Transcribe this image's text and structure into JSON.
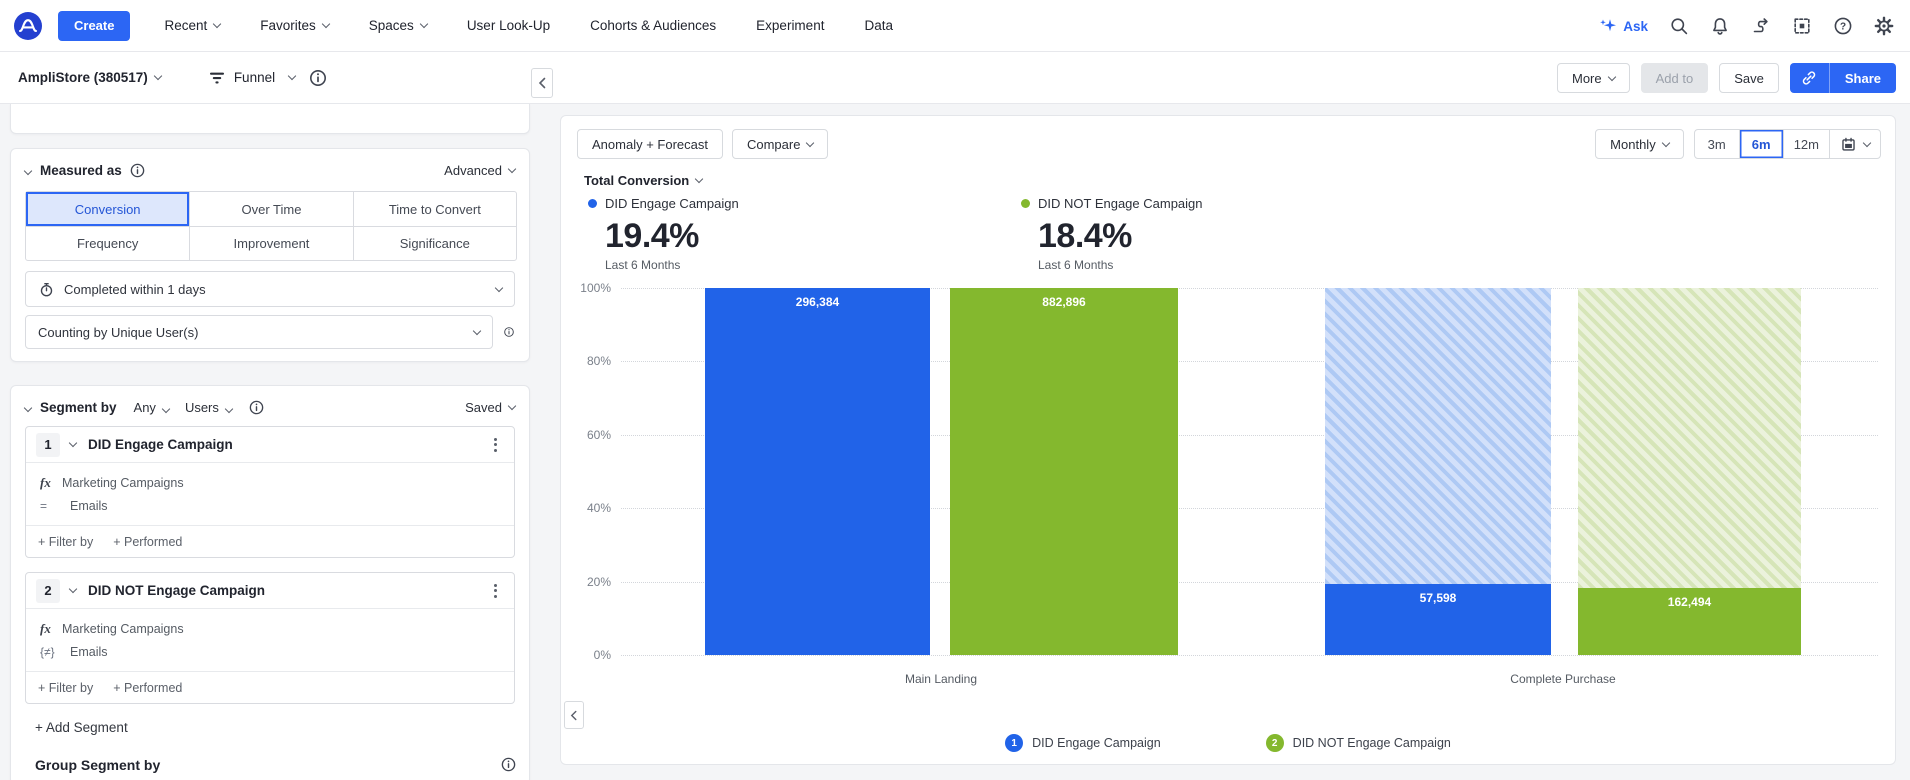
{
  "nav": {
    "create_label": "Create",
    "items": [
      {
        "label": "Recent"
      },
      {
        "label": "Favorites"
      },
      {
        "label": "Spaces"
      },
      {
        "label": "User Look-Up"
      },
      {
        "label": "Cohorts & Audiences"
      },
      {
        "label": "Experiment"
      },
      {
        "label": "Data"
      }
    ],
    "ask_label": "Ask"
  },
  "toolbar": {
    "project": "AmpliStore (380517)",
    "chart_type": "Funnel",
    "more_label": "More",
    "add_to_label": "Add to",
    "save_label": "Save",
    "share_label": "Share"
  },
  "sidebar": {
    "measured": {
      "title": "Measured as",
      "advanced_label": "Advanced",
      "tabs": [
        "Conversion",
        "Over Time",
        "Time to Convert",
        "Frequency",
        "Improvement",
        "Significance"
      ],
      "selected_tab": "Conversion",
      "completed_within": "Completed within 1 days",
      "counting_by": "Counting by Unique User(s)"
    },
    "segment": {
      "title": "Segment by",
      "any_label": "Any",
      "users_label": "Users",
      "saved_label": "Saved",
      "segments": [
        {
          "index": "1",
          "name": "DID Engage Campaign",
          "event": "Marketing Campaigns",
          "operator": "=",
          "value": "Emails",
          "filter_by": "+ Filter by",
          "performed": "+ Performed"
        },
        {
          "index": "2",
          "name": "DID NOT Engage Campaign",
          "event": "Marketing Campaigns",
          "operator": "{≠}",
          "value": "Emails",
          "filter_by": "+ Filter by",
          "performed": "+ Performed"
        }
      ],
      "add_segment_label": "+ Add Segment"
    },
    "group_segment_title": "Group Segment by"
  },
  "chart_panel": {
    "anomaly_label": "Anomaly + Forecast",
    "compare_label": "Compare",
    "interval_label": "Monthly",
    "ranges": [
      "3m",
      "6m",
      "12m"
    ],
    "active_range": "6m",
    "metric_dropdown": "Total Conversion",
    "metrics": [
      {
        "name": "DID Engage Campaign",
        "value": "19.4%",
        "period": "Last 6 Months",
        "color": "#2163e8"
      },
      {
        "name": "DID NOT Engage Campaign",
        "value": "18.4%",
        "period": "Last 6 Months",
        "color": "#84b82e"
      }
    ]
  },
  "chart_data": {
    "type": "bar",
    "subtype": "funnel-conversion",
    "title": "Total Conversion",
    "categories": [
      "Main Landing",
      "Complete Purchase"
    ],
    "series": [
      {
        "name": "DID Engage Campaign",
        "color": "#2163e8",
        "values": [
          296384,
          57598
        ],
        "value_labels": [
          "296,384",
          "57,598"
        ],
        "conversion_pct": [
          100,
          19.4
        ]
      },
      {
        "name": "DID NOT Engage Campaign",
        "color": "#84b82e",
        "values": [
          882896,
          162494
        ],
        "value_labels": [
          "882,896",
          "162,494"
        ],
        "conversion_pct": [
          100,
          18.4
        ]
      }
    ],
    "ylim": [
      0,
      100
    ],
    "yticks": [
      "100%",
      "80%",
      "60%",
      "40%",
      "20%",
      "0%"
    ],
    "grid": "dotted-horizontal",
    "legend_position": "bottom",
    "dropoff_style": "hatched-above-bar"
  },
  "legend": {
    "items": [
      {
        "badge": "1",
        "label": "DID Engage Campaign"
      },
      {
        "badge": "2",
        "label": "DID NOT Engage Campaign"
      }
    ]
  }
}
